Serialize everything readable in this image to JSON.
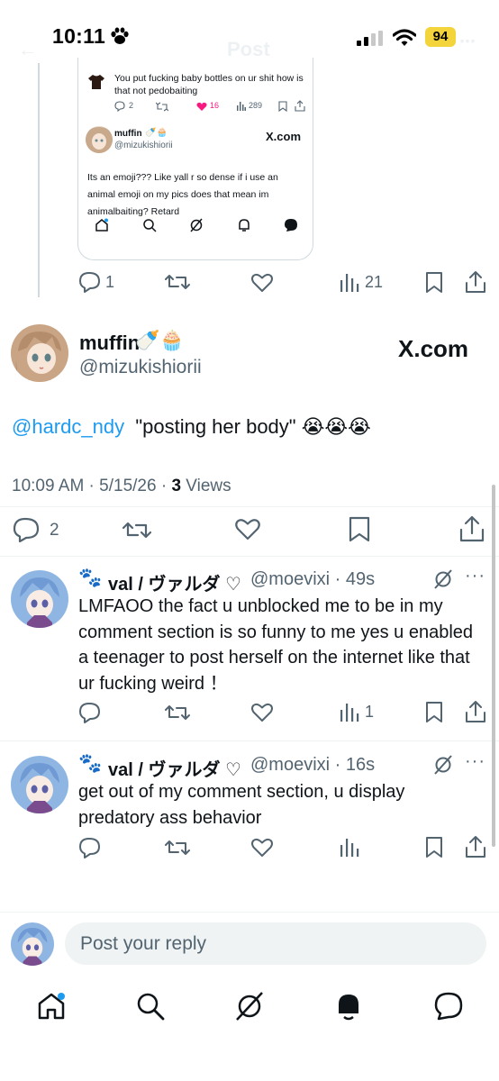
{
  "status_bar": {
    "time": "10:11",
    "battery": "94"
  },
  "header": {
    "title": "Post"
  },
  "embedded_card": {
    "quoted_text": "You put fucking baby bottles on ur shit how is that not pedobaiting",
    "reply_count": "2",
    "like_count": "16",
    "view_count": "289",
    "author_name": "muffin",
    "author_handle": "@mizukishiorii",
    "site": "X.com",
    "text": "Its an emoji??? Like yall r so dense if i use an animal emoji on my pics does that mean im animalbaiting? Retard"
  },
  "prev_actions": {
    "replies": "1",
    "views": "21"
  },
  "main_tweet": {
    "author_name": "muffin",
    "author_emoji": "🍼🧁",
    "author_handle": "@mizukishiorii",
    "site": "X.com",
    "mention": "@hardc_ndy",
    "text": "\"posting her body\" 😭😭😭",
    "timestamp": "10:09 AM · 5/15/26 · ",
    "views_count": "3",
    "views_label": " Views",
    "reply_count": "2"
  },
  "replies": [
    {
      "author_name": "val / ヴァルダ ♡",
      "author_handle": "@moevixi · 49s",
      "text": "LMFAOO the fact u unblocked me to be in my comment section is so funny to me yes u enabled a teenager to post herself on the internet like that ur fucking weird ！",
      "view_count": "1"
    },
    {
      "author_name": "val / ヴァルダ ♡",
      "author_handle": "@moevixi · 16s",
      "text": "get out of my comment section, u display predatory ass behavior",
      "view_count": ""
    }
  ],
  "composer": {
    "placeholder": "Post your reply"
  },
  "colors": {
    "accent": "#1d9bf0",
    "text": "#0f1419",
    "muted": "#536471",
    "like": "#f91880"
  }
}
